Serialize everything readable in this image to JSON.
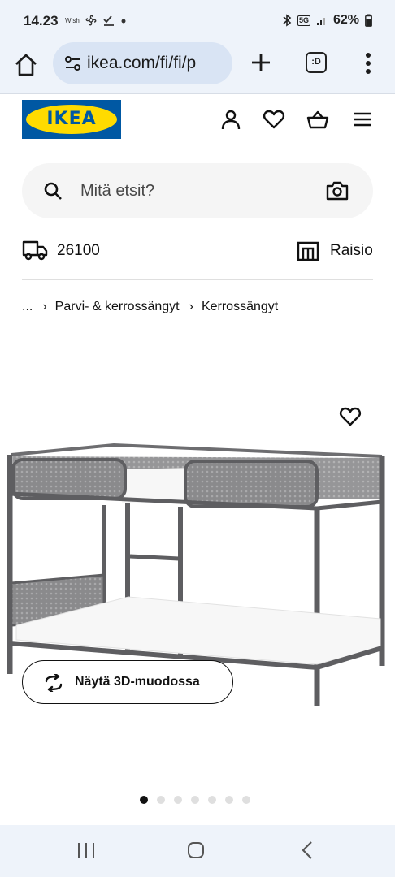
{
  "status_bar": {
    "time": "14.23",
    "app_label": "Wish",
    "network": "5G",
    "battery": "62%"
  },
  "browser": {
    "url": "ikea.com/fi/fi/p",
    "tabs_label": ":D"
  },
  "header": {
    "logo_text": "IKEA",
    "brand_colors": {
      "blue": "#0058a3",
      "yellow": "#ffdb00"
    }
  },
  "search": {
    "placeholder": "Mitä etsit?"
  },
  "delivery": {
    "postcode": "26100",
    "store": "Raisio"
  },
  "breadcrumb": {
    "ellipsis": "...",
    "items": [
      "Parvi- & kerrossängyt",
      "Kerrossängyt"
    ]
  },
  "product": {
    "view_3d_label": "Näytä 3D-muodossa"
  },
  "carousel": {
    "total": 7,
    "active_index": 0
  }
}
